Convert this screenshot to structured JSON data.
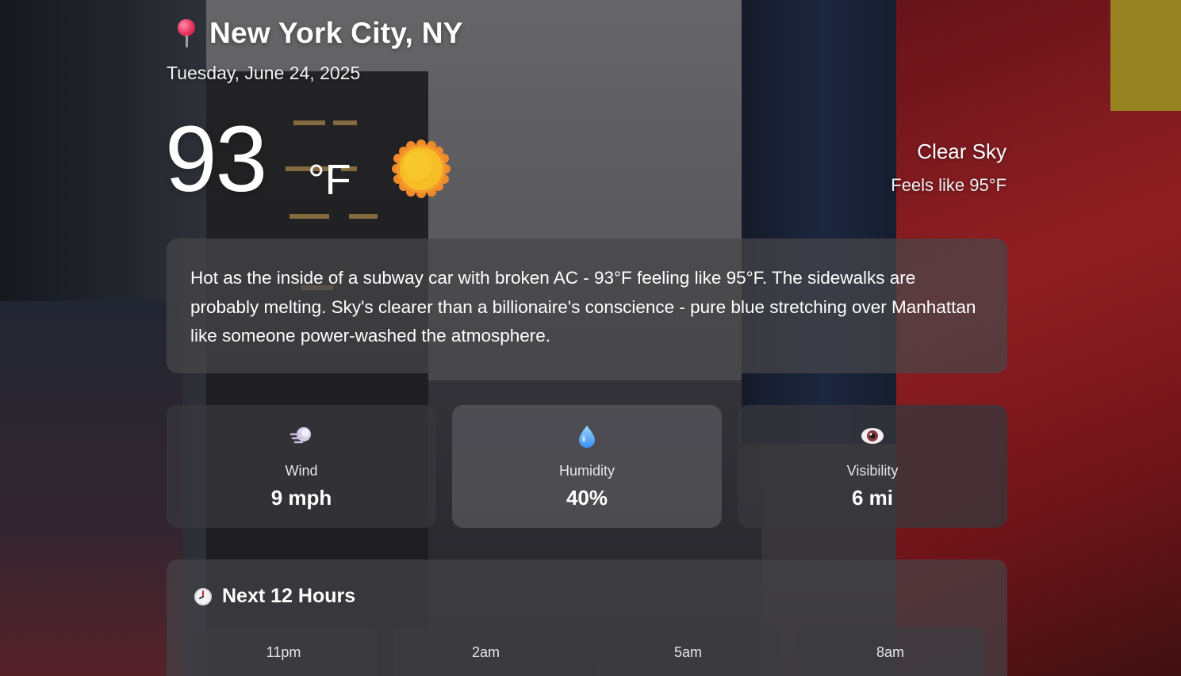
{
  "header": {
    "location": "New York City, NY",
    "date": "Tuesday, June 24, 2025",
    "location_icon": "pin-icon"
  },
  "current": {
    "temperature": "93",
    "unit": "°F",
    "condition": "Clear Sky",
    "feels_like": "Feels like 95°F",
    "condition_icon": "sun-icon"
  },
  "summary": {
    "text": "Hot as the inside of a subway car with broken AC - 93°F feeling like 95°F. The sidewalks are probably melting. Sky's clearer than a billionaire's conscience - pure blue stretching over Manhattan like someone power-washed the atmosphere."
  },
  "stats": [
    {
      "label": "Wind",
      "value": "9 mph",
      "icon": "wind-icon"
    },
    {
      "label": "Humidity",
      "value": "40%",
      "icon": "droplet-icon"
    },
    {
      "label": "Visibility",
      "value": "6 mi",
      "icon": "eye-icon"
    }
  ],
  "hourly": {
    "title": "Next 12 Hours",
    "icon": "clock-icon",
    "hours": [
      {
        "time": "11pm"
      },
      {
        "time": "2am"
      },
      {
        "time": "5am"
      },
      {
        "time": "8am"
      }
    ]
  },
  "colors": {
    "card_bg": "#46464a",
    "sun": "#f5b72a",
    "pin": "#e8325a"
  }
}
